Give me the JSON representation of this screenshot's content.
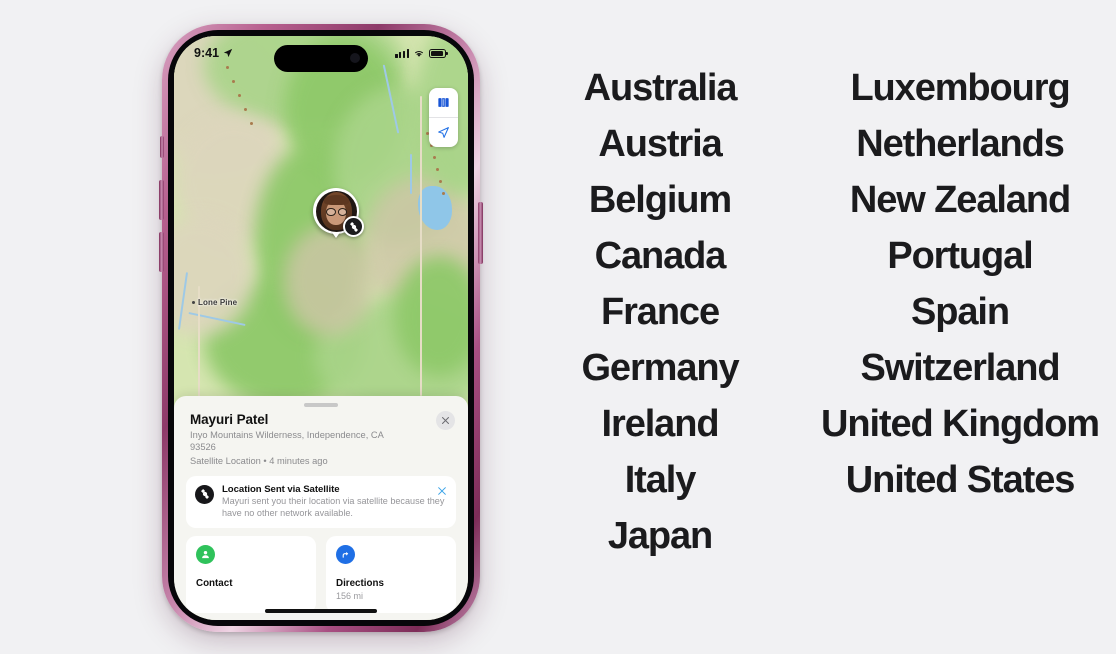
{
  "background_color": "#f1f1f3",
  "phone": {
    "frame_color": "#b8608f",
    "status_bar": {
      "time": "9:41",
      "location_arrow_icon": "location-arrow-icon",
      "signal_icon": "cellular-signal-icon",
      "wifi_icon": "wifi-icon",
      "battery_icon": "battery-icon"
    },
    "map": {
      "place_label": "Lone Pine",
      "controls": [
        {
          "name": "map-mode-button",
          "icon": "map-book-icon"
        },
        {
          "name": "current-location-button",
          "icon": "location-arrow-icon"
        }
      ],
      "pin": {
        "avatar_icon": "person-avatar",
        "badge_icon": "satellite-icon"
      }
    },
    "card": {
      "name": "Mayuri Patel",
      "address": "Inyo Mountains Wilderness, Independence, CA  93526",
      "meta": "Satellite Location • 4 minutes ago",
      "close_icon": "close-icon",
      "notification": {
        "icon": "satellite-icon",
        "title": "Location Sent via Satellite",
        "body": "Mayuri sent you their location via satellite because they have no other network available.",
        "close_icon": "close-icon",
        "close_color": "#3aa3e8"
      },
      "actions": [
        {
          "label": "Contact",
          "sublabel": "",
          "icon": "person-icon",
          "color": "#2fc25b"
        },
        {
          "label": "Directions",
          "sublabel": "156 mi",
          "icon": "directions-arrow-icon",
          "color": "#1f6fe5"
        }
      ]
    }
  },
  "countries": {
    "left_column": [
      "Australia",
      "Austria",
      "Belgium",
      "Canada",
      "France",
      "Germany",
      "Ireland",
      "Italy",
      "Japan"
    ],
    "right_column": [
      "Luxembourg",
      "Netherlands",
      "New Zealand",
      "Portugal",
      "Spain",
      "Switzerland",
      "United Kingdom",
      "United States"
    ]
  }
}
